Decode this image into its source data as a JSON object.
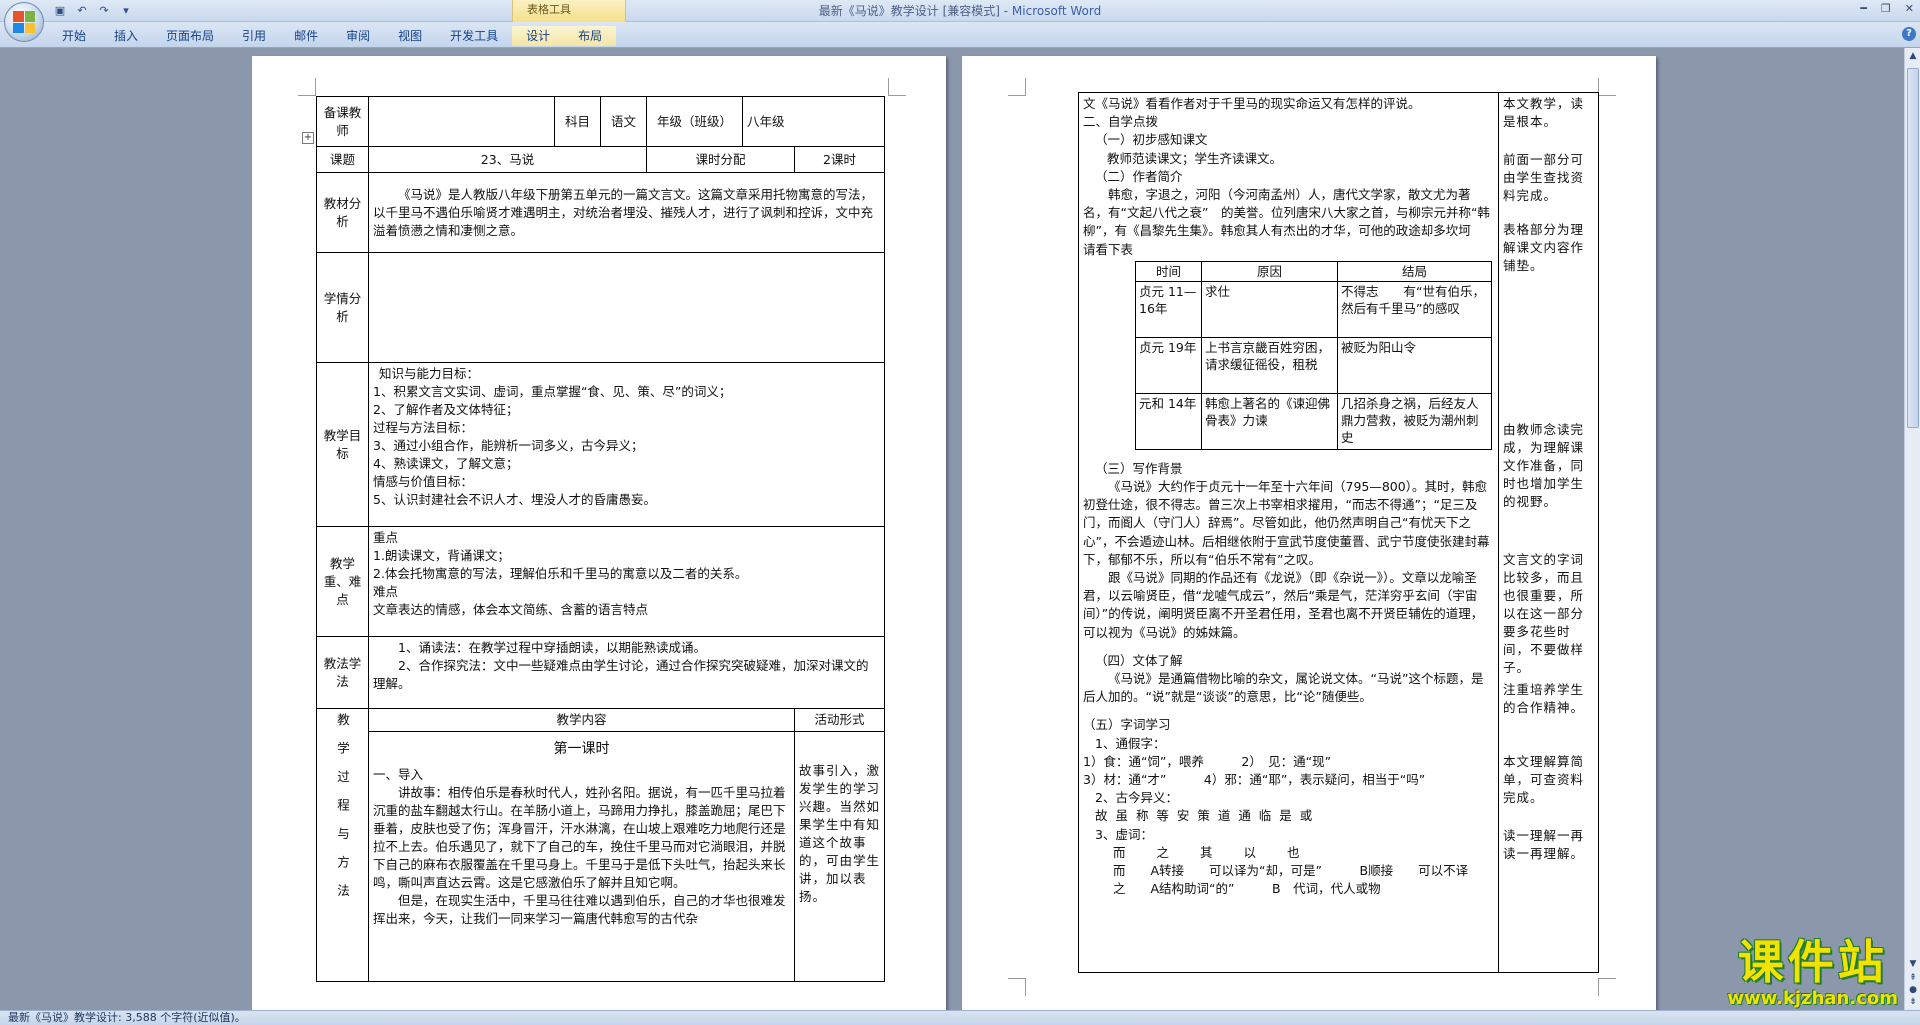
{
  "window": {
    "title_doc": "最新《马说》教学设计 [兼容模式] - ",
    "title_app": "Microsoft Word",
    "context_tab_group": "表格工具"
  },
  "ribbon": {
    "tabs": [
      "开始",
      "插入",
      "页面布局",
      "引用",
      "邮件",
      "审阅",
      "视图",
      "开发工具",
      "设计",
      "布局"
    ]
  },
  "left_page": {
    "row1": {
      "label": "备课教师",
      "subject_label": "科目",
      "subject": "语文",
      "grade_label": "年级（班级）",
      "grade": "八年级"
    },
    "row2": {
      "label": "课题",
      "title": "23、马说",
      "hours_label": "课时分配",
      "hours": "2课时"
    },
    "material": {
      "label": "教材分析",
      "text": "《马说》是人教版八年级下册第五单元的一篇文言文。这篇文章采用托物寓意的写法，以千里马不遇伯乐喻贤才难遇明主，对统治者埋没、摧残人才，进行了讽刺和控诉，文中充溢着愤懑之情和凄恻之意。"
    },
    "learning": {
      "label": "学情分析"
    },
    "goals": {
      "label": "教学目标",
      "lines": [
        "知识与能力目标：",
        "1、积累文言文实词、虚词，重点掌握“食、见、策、尽”的词义；",
        "2、了解作者及文体特征；",
        "过程与方法目标：",
        "3、通过小组合作，能辨析一词多义，古今异义；",
        "4、熟读课文，了解文意；",
        "情感与价值目标：",
        "5、认识封建社会不识人才、埋没人才的昏庸愚妄。"
      ]
    },
    "key_points": {
      "label": "教学重、难点",
      "lines": [
        "重点",
        "1.朗读课文，背诵课文；",
        "2.体会托物寓意的写法，理解伯乐和千里马的寓意以及二者的关系。",
        "难点",
        "文章表达的情感，体会本文简练、含蓄的语言特点"
      ]
    },
    "methods": {
      "label": "教法学法",
      "lines": [
        "1、诵读法：在教学过程中穿插朗读，以期能熟读成诵。",
        "2、合作探究法：文中一些疑难点由学生讨论，通过合作探究突破疑难，加深对课文的理解。"
      ]
    },
    "process": {
      "label": "教学过程与方法",
      "content_header": "教学内容",
      "activity_header": "活动形式",
      "lesson_title": "第一课时",
      "intro_heading": "一、导入",
      "intro_text": "讲故事：相传伯乐是春秋时代人，姓孙名阳。据说，有一匹千里马拉着沉重的盐车翻越太行山。在羊肠小道上，马蹄用力挣扎，膝盖跪屈；尾巴下垂着，皮肤也受了伤；浑身冒汗，汗水淋漓，在山坡上艰难吃力地爬行还是拉不上去。伯乐遇见了，就下了自己的车，挽住千里马而对它淌眼泪，并脱下自己的麻布衣服覆盖在千里马身上。千里马于是低下头吐气，抬起头来长鸣，嘶叫声直达云霄。这是它感激伯乐了解并且知它啊。",
      "intro_text2": "但是，在现实生活中，千里马往往难以遇到伯乐，自己的才华也很难发挥出来，今天，让我们一同来学习一篇唐代韩愈写的古代杂",
      "activity_text": "故事引入，激发学生的学习兴趣。当然如果学生中有知道这个故事的，可由学生讲，加以表扬。"
    }
  },
  "right_page": {
    "continuation": "文《马说》看看作者对于千里马的现实命运又有怎样的评说。",
    "self_study": "二、自学点拨",
    "perceive": "（一）初步感知课文",
    "perceive_text": "教师范读课文；学生齐读课文。",
    "author": "（二）作者简介",
    "author_text": "韩愈，字退之，河阳（今河南孟州）人，唐代文学家，散文尤为著名，有“文起八代之衰”　的美誉。位列唐宋八大家之首，与柳宗元并称“韩柳”，有《昌黎先生集》。韩愈其人有杰出的才华，可他的政途却多坎坷　　请看下表",
    "timeline": {
      "headers": [
        "时间",
        "原因",
        "结局"
      ],
      "rows": [
        [
          "贞元 11—16年",
          "求仕",
          "不得志　　有“世有伯乐，然后有千里马”的感叹"
        ],
        [
          "贞元 19年",
          "上书言京畿百姓穷困，请求缓征徭役，租税",
          "被贬为阳山令"
        ],
        [
          "元和 14年",
          "韩愈上著名的《谏迎佛骨表》力谏",
          "几招杀身之祸，后经友人鼎力营救，被贬为潮州刺史"
        ]
      ]
    },
    "background": "（三）写作背景",
    "background_text": "《马说》大约作于贞元十一年至十六年间（795—800）。其时，韩愈初登仕途，很不得志。曾三次上书宰相求擢用，“而志不得通”；“足三及门，而阍人（守门人）辞焉”。尽管如此，他仍然声明自己“有忧天下之心”，不会遁迹山林。后相继依附于宣武节度使董晋、武宁节度使张建封幕下，郁郁不乐，所以有“伯乐不常有”之叹。",
    "background_text2": "跟《马说》同期的作品还有《龙说》（即《杂说一》）。文章以龙喻圣君，以云喻贤臣，借“龙嘘气成云”，然后“乘是气，茫洋穷乎玄间（宇宙间）”的传说，阐明贤臣离不开圣君任用，圣君也离不开贤臣辅佐的道理，可以视为《马说》的姊妹篇。",
    "genre": "（四）文体了解",
    "genre_text": "《马说》是通篇借物比喻的杂文，属论说文体。“马说”这个标题，是后人加的。“说”就是“谈谈”的意思，比“论”随便些。",
    "words": "（五）字词学习",
    "tongjia": "1、通假字：",
    "tongjia1": "1）食：通“饲”，喂养　　　2）　见：通“现”",
    "tongjia2": "3）材：通“才”　　　4）邪：通“耶”，表示疑问，相当于“吗”",
    "gujin": "2、古今异义：",
    "gujin_words": "故 虽 称 等 安 策 道 通 临 是 或",
    "xuci": "3、虚词：",
    "xuci_words": "而　　之　　其　　以　　也",
    "xuci_er": "而　　A转接　　可以译为“却，可是”　　　B顺接　　可以不译",
    "xuci_zhi": "之　　A结构助词“的”　　　B　代词，代人或物",
    "side_notes": [
      "本文教学，读是根本。",
      "前面一部分可由学生查找资料完成。",
      "表格部分为理解课文内容作铺垫。",
      "由教师念读完成，为理解课文作准备，同时也增加学生的视野。",
      "文言文的字词比较多，而且也很重要，所以在这一部分要多花些时间，不要做样子。",
      "注重培养学生的合作精神。",
      "本文理解算简单，可查资料完成。",
      "读一理解一再读一再理解。"
    ]
  },
  "status_bar": {
    "text": "最新《马说》教学设计: 3,588 个字符(近似值)。"
  },
  "watermark": {
    "title": "课件站",
    "url": "www.kjzhan.com"
  }
}
